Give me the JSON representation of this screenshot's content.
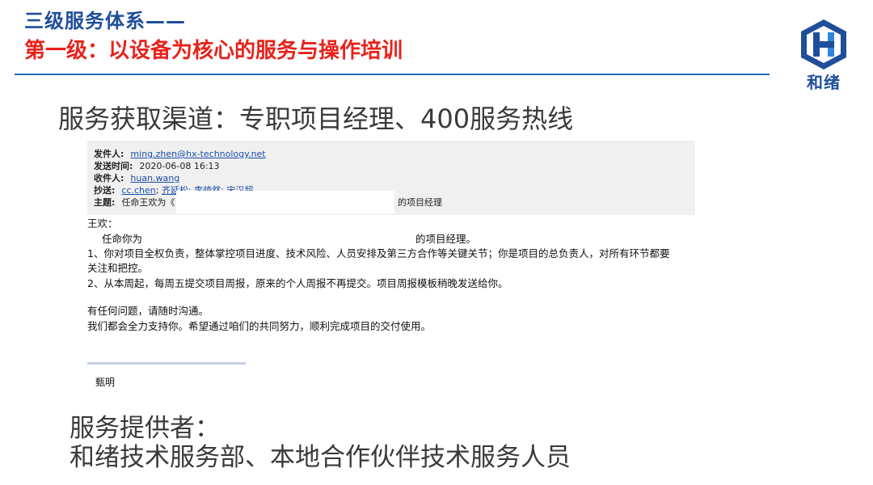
{
  "header": {
    "title": "三级服务体系——",
    "subtitle": "第一级：以设备为核心的服务与操作培训"
  },
  "logo": {
    "icon": "hexagon-h-logo",
    "text": "和绪",
    "color": "#1f4e9a"
  },
  "channel": "服务获取渠道：专职项目经理、400服务热线",
  "email": {
    "from_label": "发件人:",
    "from": "ming.zhen@hx-technology.net",
    "sent_label": "发送时间:",
    "sent": "2020-06-08 16:13",
    "to_label": "收件人:",
    "to": "huan.wang",
    "cc_label": "抄送:",
    "cc_1": "cc.chen",
    "cc_2": "齐延松; 李帅然; 宋汉超",
    "subject_label": "主题:",
    "subject_start": "任命王欢为《",
    "subject_end": "的项目经理",
    "greeting": "王欢：",
    "appoint_start": "任命你为",
    "appoint_end": "的项目经理。",
    "point1_a": "1、你对项目全权负责，整体掌控项目进度、技术风险、人员安排及第三方合作等关键关节；你是项目的总负责人，对所有环节都要",
    "point1_b": "关注和把控。",
    "point2": "2、从本周起，每周五提交项目周报，原来的个人周报不再提交。项目周报模板稍晚发送给你。",
    "closing1": "有任何问题，请随时沟通。",
    "closing2": "我们都会全力支持你。希望通过咱们的共同努力，顺利完成项目的交付使用。",
    "signature": "甄明"
  },
  "provider": {
    "label": "服务提供者：",
    "value": "和绪技术服务部、本地合作伙伴技术服务人员"
  },
  "colors": {
    "title": "#1f4e9a",
    "subtitle": "#e8221b",
    "rule": "#2a6ab8",
    "email_bg": "#f0f0f0"
  }
}
